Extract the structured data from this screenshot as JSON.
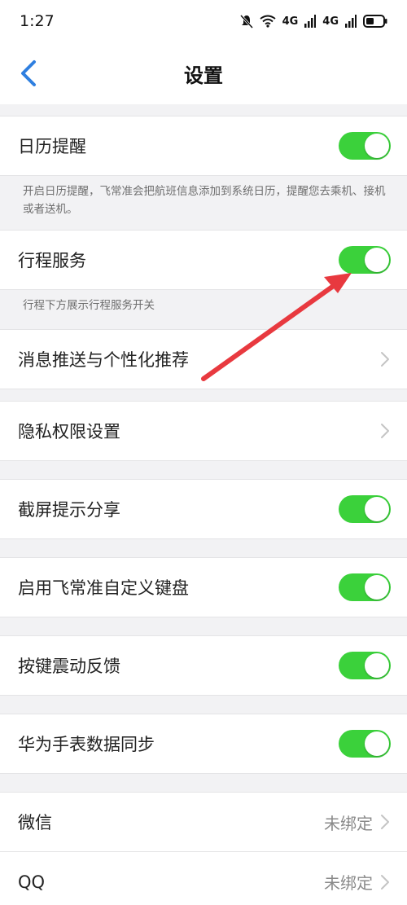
{
  "status": {
    "time": "1:27",
    "signal1": "4G",
    "signal2": "4G"
  },
  "nav": {
    "title": "设置"
  },
  "sections": {
    "calendar": {
      "label": "日历提醒",
      "on": true,
      "desc": "开启日历提醒，飞常准会把航班信息添加到系统日历，提醒您去乘机、接机或者送机。"
    },
    "trip": {
      "label": "行程服务",
      "on": true,
      "desc": "行程下方展示行程服务开关"
    },
    "push": {
      "label": "消息推送与个性化推荐"
    },
    "privacy": {
      "label": "隐私权限设置"
    },
    "screenshot": {
      "label": "截屏提示分享",
      "on": true
    },
    "keyboard": {
      "label": "启用飞常准自定义键盘",
      "on": true
    },
    "vibration": {
      "label": "按键震动反馈",
      "on": true
    },
    "huawei": {
      "label": "华为手表数据同步",
      "on": true
    },
    "wechat": {
      "label": "微信",
      "value": "未绑定"
    },
    "qq": {
      "label": "QQ",
      "value": "未绑定"
    }
  },
  "colors": {
    "toggle_on": "#3bd13b",
    "accent": "#2f7fe0",
    "annotation_arrow": "#e8393f"
  }
}
